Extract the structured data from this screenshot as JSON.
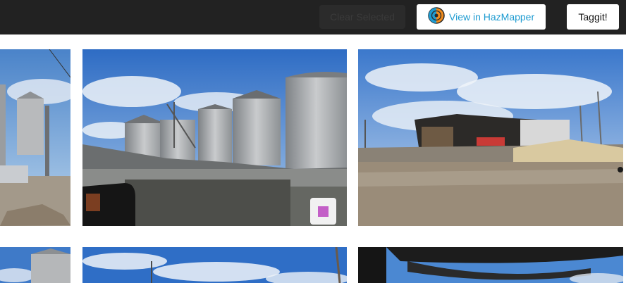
{
  "toolbar": {
    "clear_selected_label": "Clear Selected",
    "hazmapper_label": "View in HazMapper",
    "taggit_label": "Taggit!"
  },
  "icons": {
    "hazmapper_logo": "hazmapper-logo-icon",
    "select_marker": "selected-square-icon"
  },
  "colors": {
    "topbar_bg": "#222222",
    "accent": "#1d9bd1",
    "selection_marker": "#c35fc7"
  }
}
